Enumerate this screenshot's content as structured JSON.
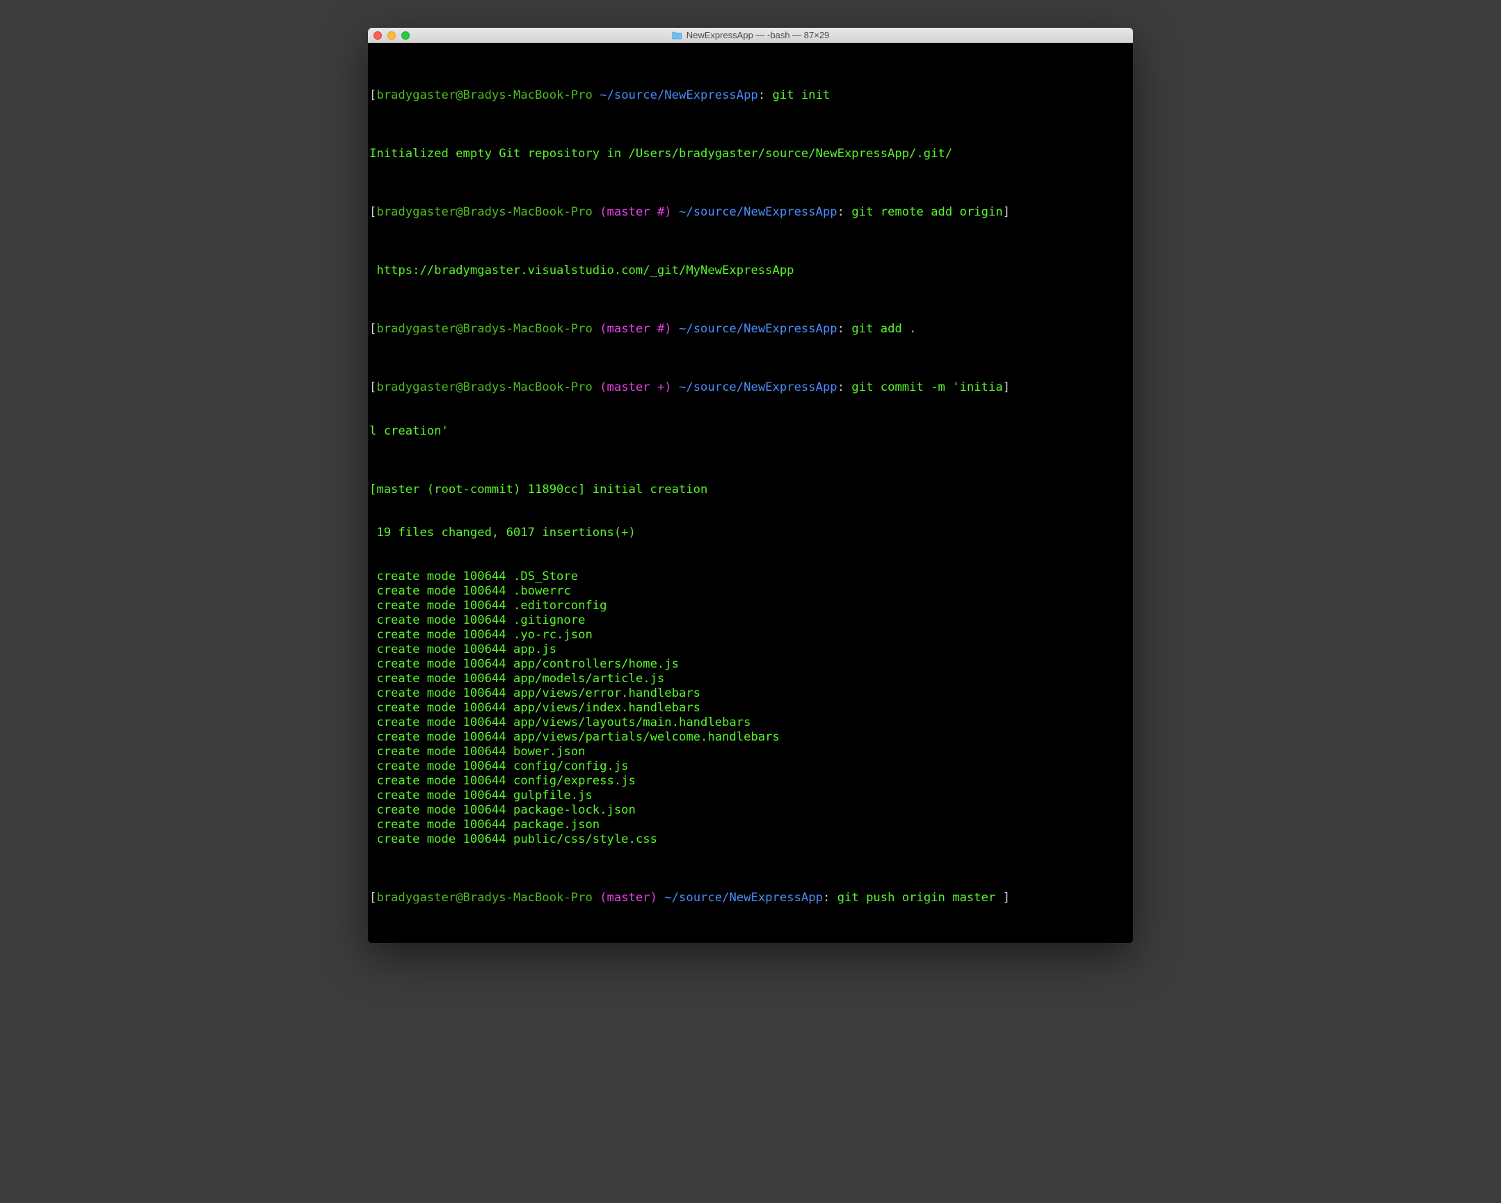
{
  "window": {
    "title": "NewExpressApp — -bash — 87×29"
  },
  "prompt": {
    "user_host": "bradygaster@Bradys-MacBook-Pro",
    "branch_hash": "(master #)",
    "branch_plus": "(master +)",
    "branch_clean": "(master)",
    "path": "~/source/NewExpressApp",
    "colon": ":"
  },
  "commands": {
    "git_init": "git init",
    "git_remote": "git remote add origin",
    "git_add": "git add .",
    "git_commit_part1": "git commit -m 'initia",
    "git_commit_part2": "l creation'",
    "git_push": "git push origin master"
  },
  "output": {
    "init": "Initialized empty Git repository in /Users/bradygaster/source/NewExpressApp/.git/",
    "remote_url": " https://bradymgaster.visualstudio.com/_git/MyNewExpressApp",
    "commit_head": "[master (root-commit) 11890cc] initial creation",
    "summary": " 19 files changed, 6017 insertions(+)",
    "files": [
      " create mode 100644 .DS_Store",
      " create mode 100644 .bowerrc",
      " create mode 100644 .editorconfig",
      " create mode 100644 .gitignore",
      " create mode 100644 .yo-rc.json",
      " create mode 100644 app.js",
      " create mode 100644 app/controllers/home.js",
      " create mode 100644 app/models/article.js",
      " create mode 100644 app/views/error.handlebars",
      " create mode 100644 app/views/index.handlebars",
      " create mode 100644 app/views/layouts/main.handlebars",
      " create mode 100644 app/views/partials/welcome.handlebars",
      " create mode 100644 bower.json",
      " create mode 100644 config/config.js",
      " create mode 100644 config/express.js",
      " create mode 100644 gulpfile.js",
      " create mode 100644 package-lock.json",
      " create mode 100644 package.json",
      " create mode 100644 public/css/style.css"
    ]
  },
  "brackets": {
    "l": "[",
    "r": "]"
  }
}
